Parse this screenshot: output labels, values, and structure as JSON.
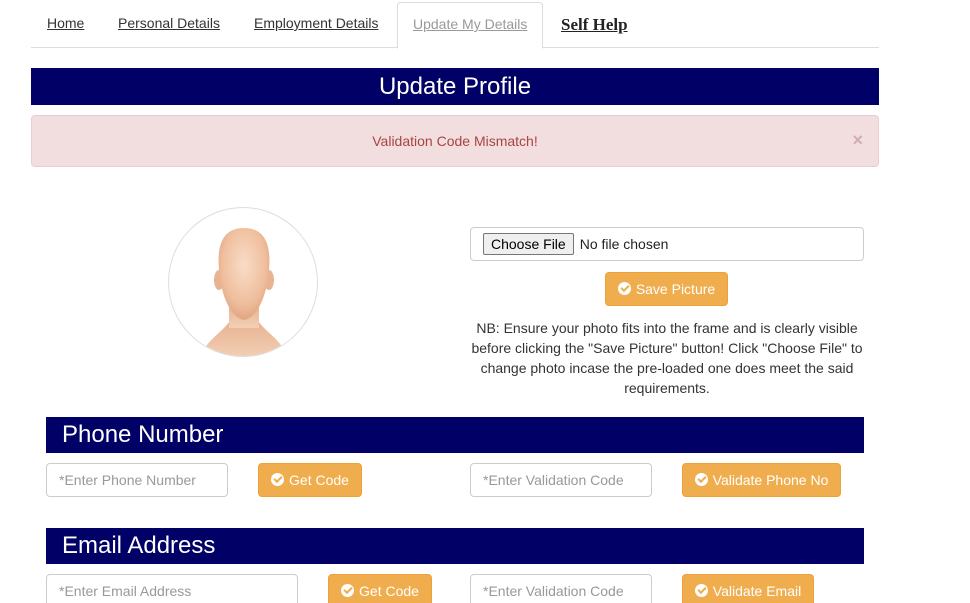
{
  "nav": {
    "items": [
      {
        "label": "Home",
        "active": false
      },
      {
        "label": "Personal Details",
        "active": false
      },
      {
        "label": "Employment Details",
        "active": false
      },
      {
        "label": "Update My Details",
        "active": true
      },
      {
        "label": "Self Help",
        "active": false
      }
    ]
  },
  "page": {
    "title": "Update Profile"
  },
  "alert": {
    "message": "Validation Code Mismatch!",
    "close_label": "×"
  },
  "photo": {
    "avatar_icon": "faceless-head-placeholder",
    "file_button_label": "Choose File",
    "file_status": "No file chosen",
    "save_button_label": "Save Picture",
    "note": "NB: Ensure your photo fits into the frame and is clearly visible before clicking the \"Save Picture\" button! Click \"Choose File\" to change photo incase the pre-loaded one does meet the said requirements."
  },
  "phone": {
    "header": "Phone Number",
    "input_placeholder": "*Enter Phone Number",
    "input_value": "",
    "get_code_label": "Get Code",
    "validation_placeholder": "*Enter Validation Code",
    "validation_value": "",
    "validate_label": "Validate Phone No"
  },
  "email": {
    "header": "Email Address",
    "input_placeholder": "*Enter Email Address",
    "input_value": "",
    "get_code_label": "Get Code",
    "validation_placeholder": "*Enter Validation Code",
    "validation_value": "",
    "validate_label": "Validate Email"
  },
  "colors": {
    "header_bg": "#000066",
    "button_orange": "#f0ad4e",
    "alert_bg": "#f2dede",
    "alert_text": "#a94442"
  }
}
